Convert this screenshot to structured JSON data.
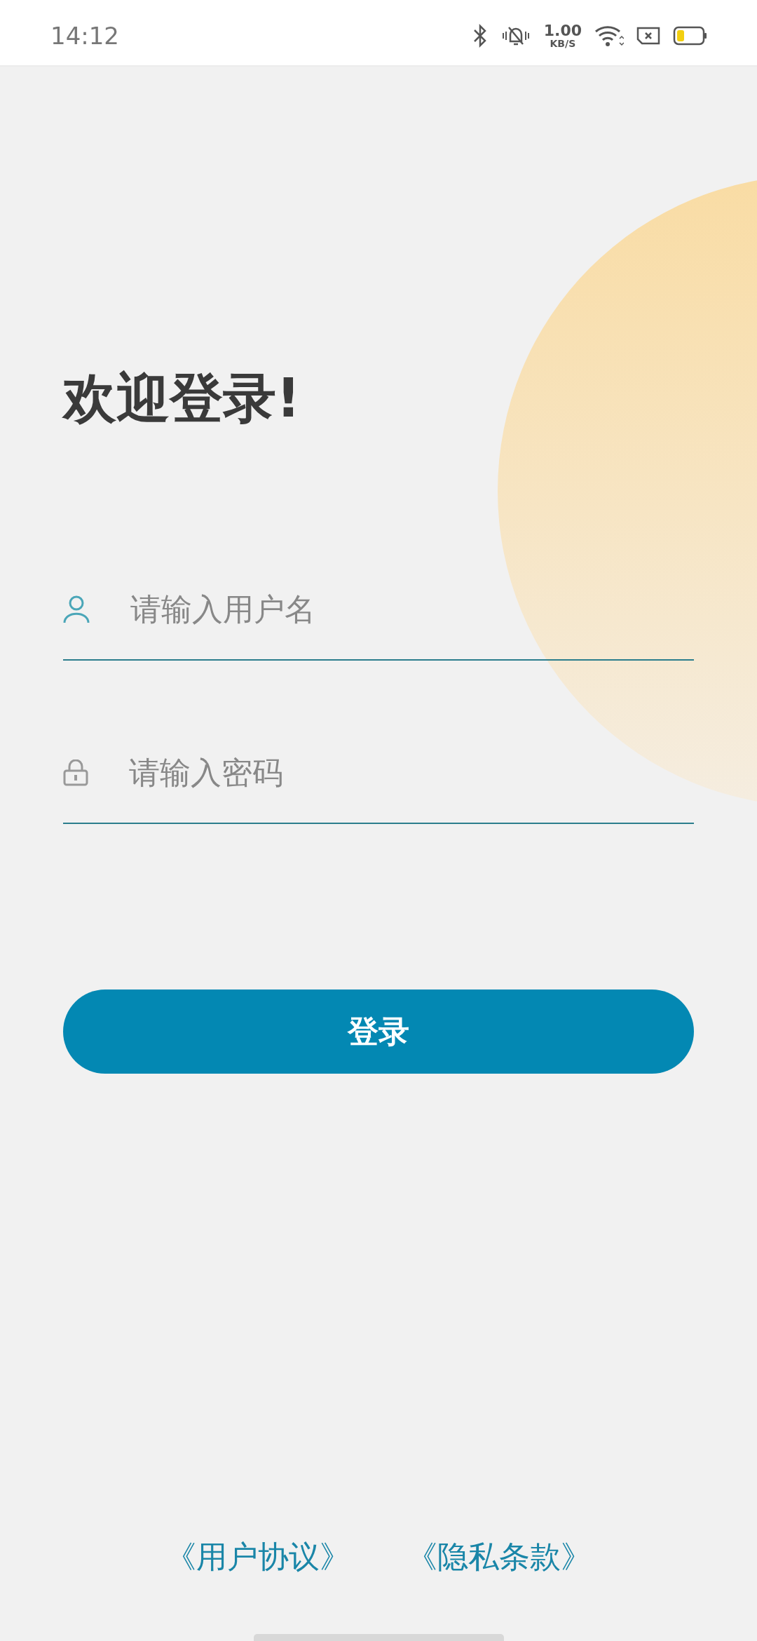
{
  "status_bar": {
    "time": "14:12",
    "speed_value": "1.00",
    "speed_unit": "KB/S"
  },
  "title": "欢迎登录!",
  "fields": [
    {
      "kind": "username",
      "placeholder": "请输入用户名"
    },
    {
      "kind": "password",
      "placeholder": "请输入密码"
    }
  ],
  "login_button": "登录",
  "links": [
    "《用户协议》",
    "《隐私条款》"
  ]
}
